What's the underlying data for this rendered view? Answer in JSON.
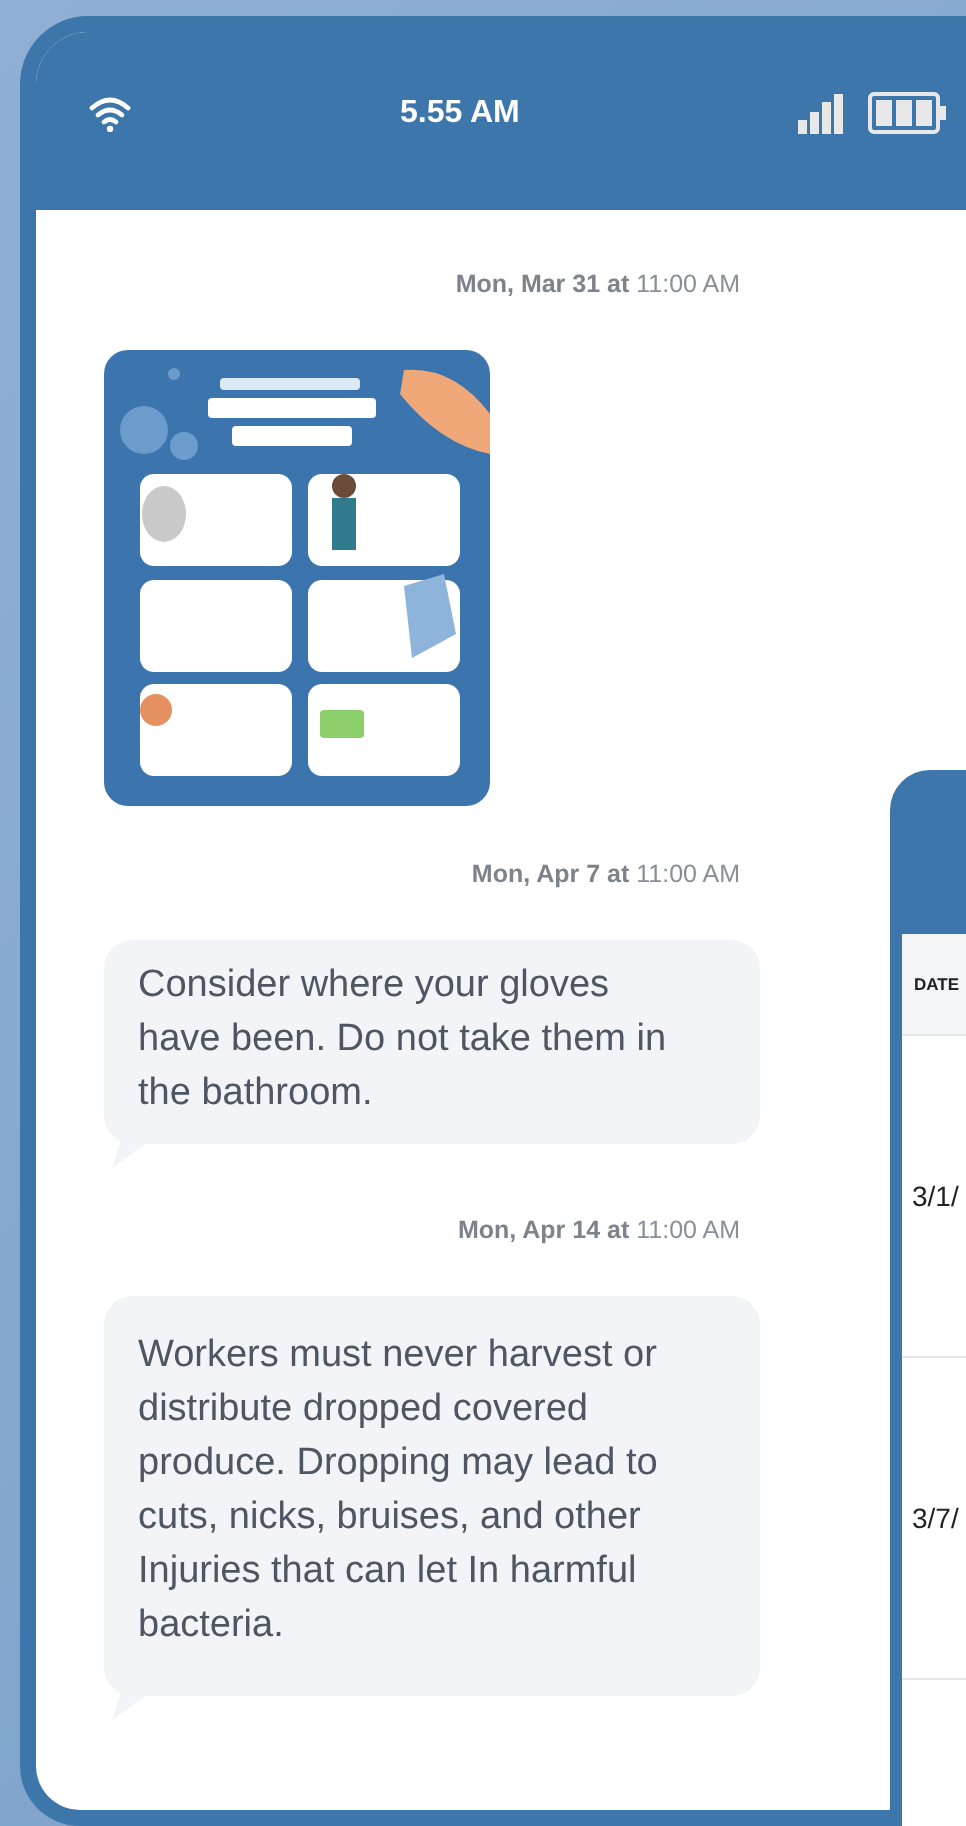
{
  "status_bar": {
    "time": "5.55 AM"
  },
  "messages": [
    {
      "kind": "image",
      "timestamp": "**Mon, Mar 31 at** 11:00 AM"
    },
    {
      "kind": "text",
      "timestamp": "**Mon, Apr 7 at** 11:00 AM",
      "text": "Consider where your gloves have been. Do not take them in the bathroom."
    },
    {
      "kind": "text",
      "timestamp": "**Mon, Apr 14 at** 11:00 AM",
      "text": "Workers must never harvest or distribute dropped covered produce. Dropping may lead to cuts, nicks, bruises, and other Injuries that can let In harmful bacteria."
    }
  ],
  "background_screen": {
    "table": {
      "columns": [
        "DATE"
      ],
      "rows": [
        [
          "3/1/"
        ],
        [
          "3/7/"
        ]
      ]
    }
  }
}
